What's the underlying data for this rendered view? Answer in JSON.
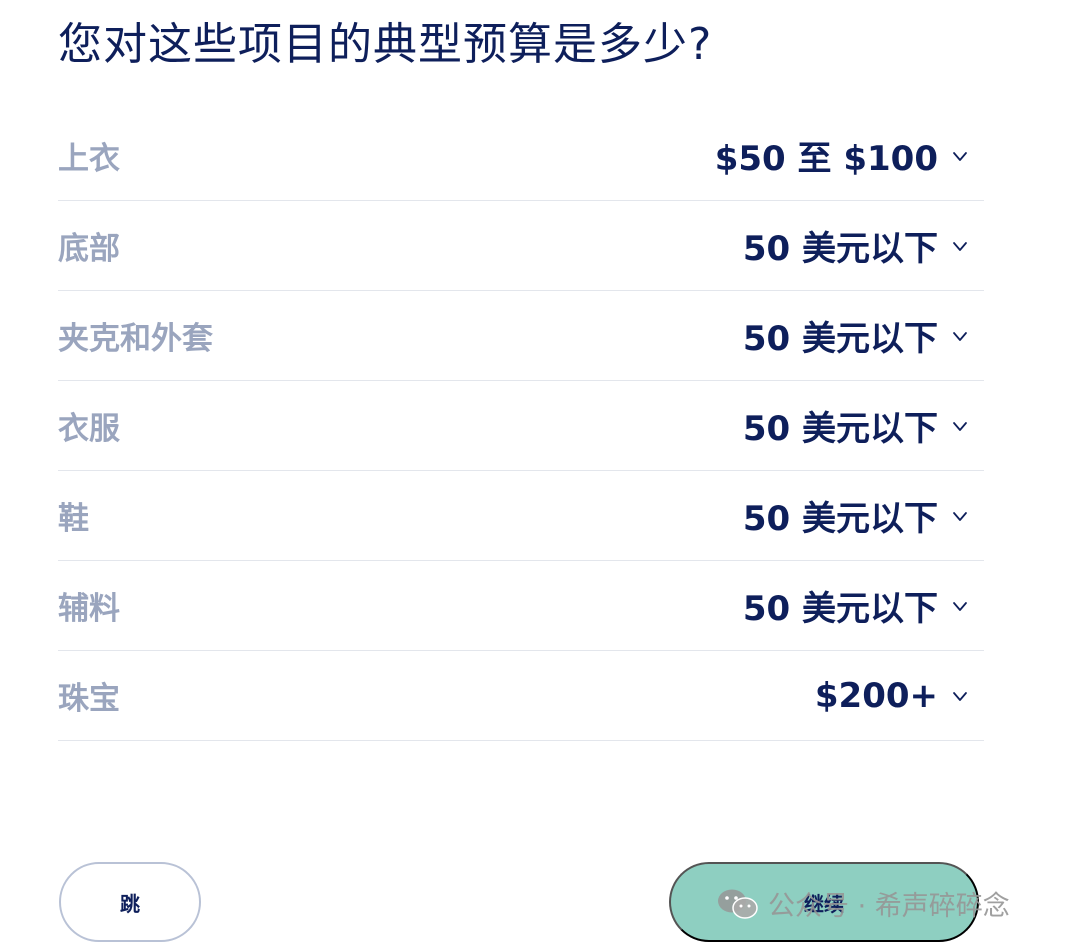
{
  "question": "您对这些项目的典型预算是多少?",
  "rows": [
    {
      "label": "上衣",
      "value": "$50 至 $100"
    },
    {
      "label": "底部",
      "value": "50 美元以下"
    },
    {
      "label": "夹克和外套",
      "value": "50 美元以下"
    },
    {
      "label": "衣服",
      "value": "50 美元以下"
    },
    {
      "label": "鞋",
      "value": "50 美元以下"
    },
    {
      "label": "辅料",
      "value": "50 美元以下"
    },
    {
      "label": "珠宝",
      "value": "$200+"
    }
  ],
  "buttons": {
    "skip": "跳",
    "continue": "继续"
  },
  "watermark": "公众号 · 希声碎碎念",
  "colors": {
    "navy": "#0e1f5b",
    "label_gray": "#9aa5be",
    "accent_teal": "#8ecfc1",
    "divider": "#e3e6ec"
  }
}
